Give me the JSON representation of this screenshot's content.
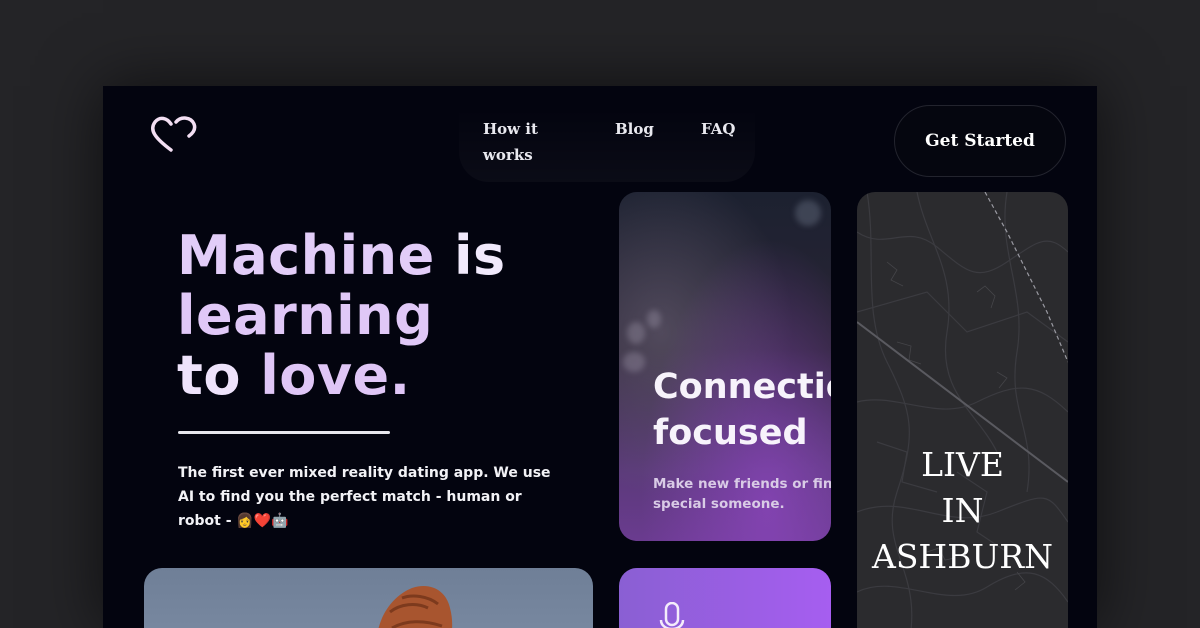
{
  "nav": {
    "how_it_works": "How it works",
    "blog": "Blog",
    "faq": "FAQ",
    "cta": "Get Started"
  },
  "hero": {
    "line1a": "Machine",
    "line1b": "is",
    "line2": "learning",
    "line3a": "to",
    "line3b": "love.",
    "subtitle": "The first ever mixed reality dating app. We use AI to find you the perfect match - human or robot - 👩❤️🤖"
  },
  "cards": {
    "connection": {
      "title1": "Connectio",
      "title2": "focused",
      "text1": "Make new friends or find th",
      "text2": "special someone."
    },
    "live": {
      "line1": "LIVE",
      "line2": "IN",
      "line3": "ASHBURN"
    }
  },
  "icons": {
    "logo": "heart-outline-icon",
    "voice": "microphone-icon"
  },
  "colors": {
    "background": "#03040f",
    "accent": "#e0c8f7",
    "purple": "#a65ef0"
  }
}
